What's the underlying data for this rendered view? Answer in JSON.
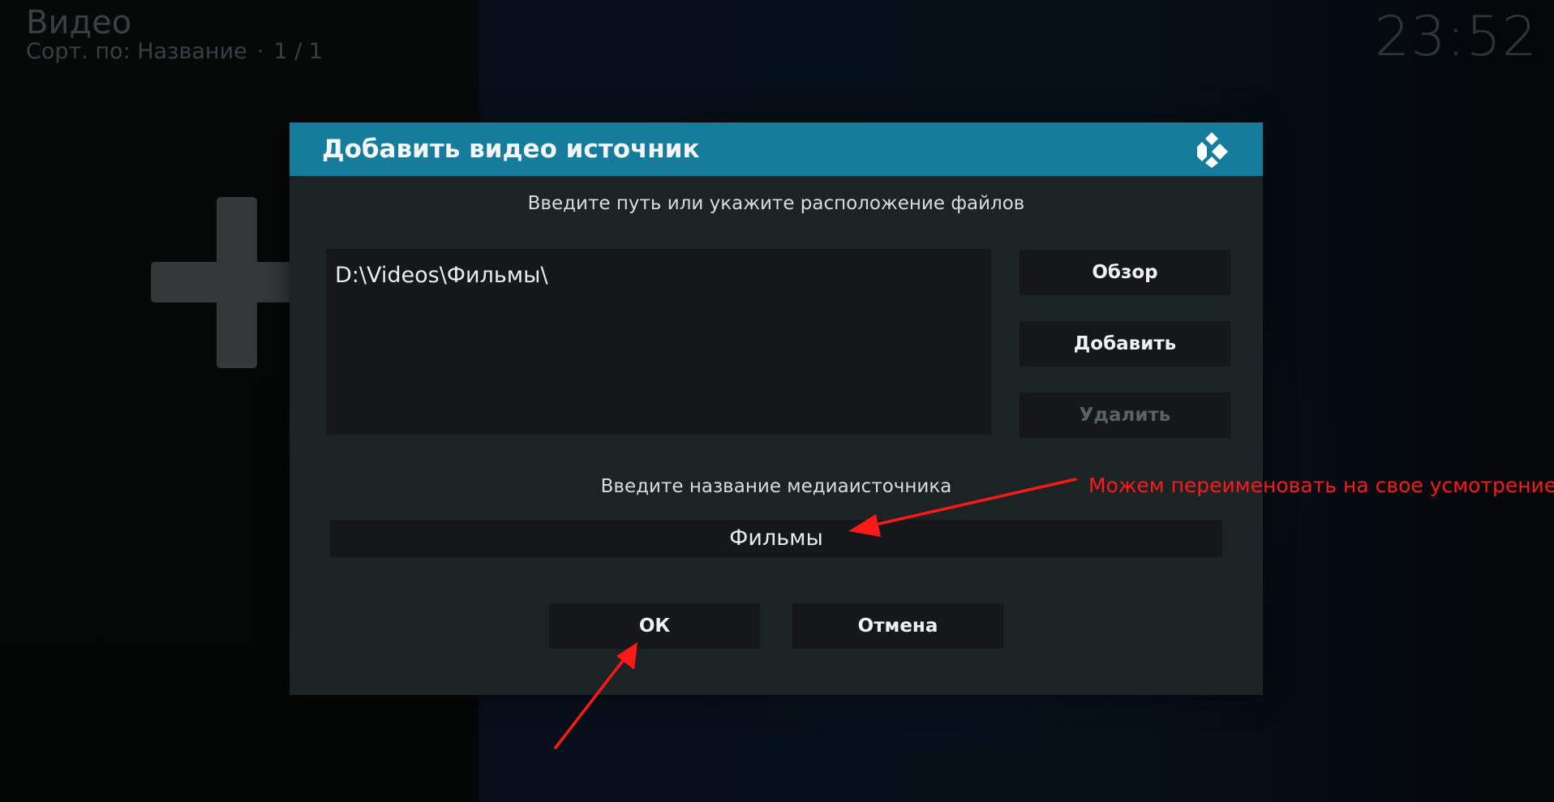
{
  "header": {
    "section_title": "Видео",
    "sort_label": "Сорт. по: Название",
    "separator": "·",
    "page_counter": "1 / 1",
    "clock": "23:52"
  },
  "dialog": {
    "title": "Добавить видео источник",
    "path_prompt": "Введите путь или укажите расположение файлов",
    "paths": [
      "D:\\Videos\\Фильмы\\"
    ],
    "browse_label": "Обзор",
    "add_label": "Добавить",
    "remove_label": "Удалить",
    "name_prompt": "Введите название медиаисточника",
    "name_value": "Фильмы",
    "ok_label": "ОК",
    "cancel_label": "Отмена"
  },
  "annotation": {
    "text": "Можем переименовать на свое усмотрение",
    "color": "#ff1a1a"
  },
  "colors": {
    "header_accent": "#157d9b",
    "dialog_bg": "#1c2325",
    "control_bg": "#141819"
  },
  "icons": {
    "logo": "kodi-logo-icon",
    "background_add": "plus-icon"
  }
}
